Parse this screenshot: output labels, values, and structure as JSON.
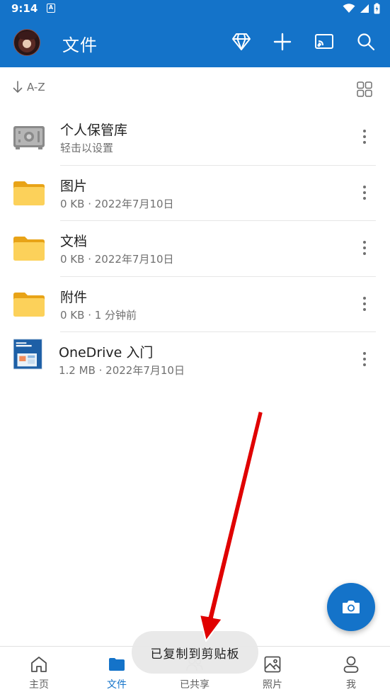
{
  "status_bar": {
    "time": "9:14",
    "notification_letter": "A"
  },
  "app_bar": {
    "title": "文件",
    "icons": [
      "diamond-icon",
      "plus-icon",
      "cast-icon",
      "search-icon"
    ]
  },
  "sort": {
    "label": "A-Z"
  },
  "files": [
    {
      "name": "个人保管库",
      "meta": "轻击以设置",
      "icon": "vault-icon"
    },
    {
      "name": "图片",
      "meta": "0 KB · 2022年7月10日",
      "icon": "folder-icon"
    },
    {
      "name": "文档",
      "meta": "0 KB · 2022年7月10日",
      "icon": "folder-icon"
    },
    {
      "name": "附件",
      "meta": "0 KB · 1 分钟前",
      "icon": "folder-icon"
    },
    {
      "name": "OneDrive 入门",
      "meta": "1.2 MB · 2022年7月10日",
      "icon": "pdf-thumbnail"
    }
  ],
  "bottom_nav": [
    {
      "label": "主页",
      "icon": "home-icon",
      "active": false
    },
    {
      "label": "文件",
      "icon": "folder-icon",
      "active": true
    },
    {
      "label": "已共享",
      "icon": "shared-icon",
      "active": false
    },
    {
      "label": "照片",
      "icon": "photo-icon",
      "active": false
    },
    {
      "label": "我",
      "icon": "person-icon",
      "active": false
    }
  ],
  "toast": "已复制到剪贴板",
  "colors": {
    "brand": "#1473c9",
    "folder": "#fbc42f",
    "annotation_arrow": "#e00000"
  }
}
